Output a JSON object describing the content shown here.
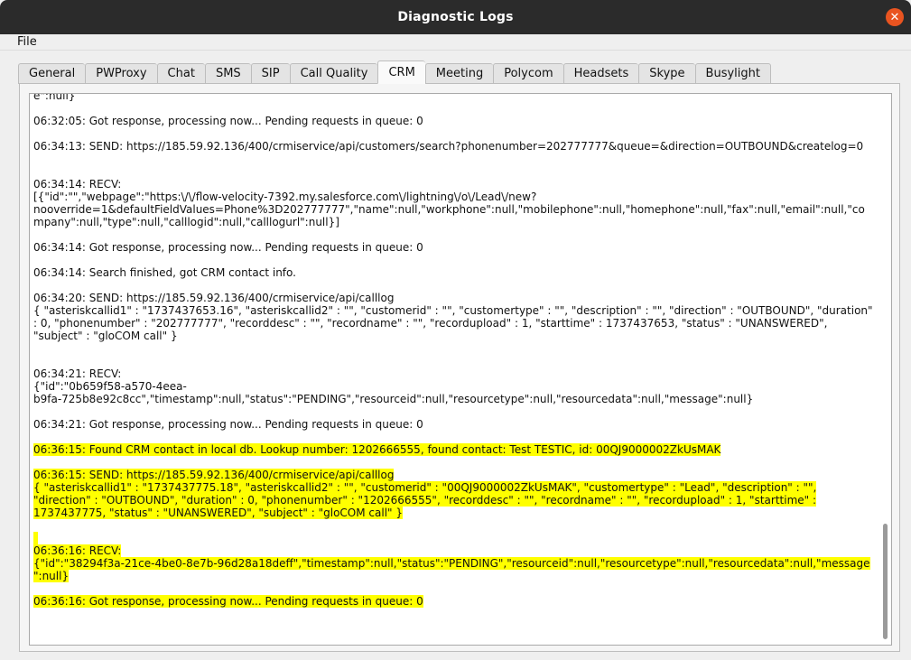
{
  "window": {
    "title": "Diagnostic Logs"
  },
  "menu": {
    "file": "File"
  },
  "tabs": [
    {
      "label": "General"
    },
    {
      "label": "PWProxy"
    },
    {
      "label": "Chat"
    },
    {
      "label": "SMS"
    },
    {
      "label": "SIP"
    },
    {
      "label": "Call Quality"
    },
    {
      "label": "CRM"
    },
    {
      "label": "Meeting"
    },
    {
      "label": "Polycom"
    },
    {
      "label": "Headsets"
    },
    {
      "label": "Skype"
    },
    {
      "label": "Busylight"
    }
  ],
  "active_tab": "CRM",
  "log": [
    {
      "text": "e\":null}",
      "highlight": false
    },
    {
      "text": "06:32:05: Got response, processing now... Pending requests in queue: 0",
      "highlight": false
    },
    {
      "text": "06:34:13: SEND: https://185.59.92.136/400/crmiservice/api/customers/search?phonenumber=202777777&queue=&direction=OUTBOUND&createlog=0",
      "highlight": false,
      "extra_blank": true
    },
    {
      "text": "06:34:14: RECV:\n[{\"id\":\"\",\"webpage\":\"https:\\/\\/flow-velocity-7392.my.salesforce.com\\/lightning\\/o\\/Lead\\/new?\nnooverride=1&defaultFieldValues=Phone%3D202777777\",\"name\":null,\"workphone\":null,\"mobilephone\":null,\"homephone\":null,\"fax\":null,\"email\":null,\"co\nmpany\":null,\"type\":null,\"calllogid\":null,\"calllogurl\":null}]",
      "highlight": false
    },
    {
      "text": "06:34:14: Got response, processing now... Pending requests in queue: 0",
      "highlight": false
    },
    {
      "text": "06:34:14: Search finished, got CRM contact info.",
      "highlight": false
    },
    {
      "text": "06:34:20: SEND: https://185.59.92.136/400/crmiservice/api/calllog\n{ \"asteriskcallid1\" : \"1737437653.16\", \"asteriskcallid2\" : \"\", \"customerid\" : \"\", \"customertype\" : \"\", \"description\" : \"\", \"direction\" : \"OUTBOUND\", \"duration\"\n: 0, \"phonenumber\" : \"202777777\", \"recorddesc\" : \"\", \"recordname\" : \"\", \"recordupload\" : 1, \"starttime\" : 1737437653, \"status\" : \"UNANSWERED\",\n\"subject\" : \"gloCOM call\" }",
      "highlight": false,
      "extra_blank": true
    },
    {
      "text": "06:34:21: RECV:\n{\"id\":\"0b659f58-a570-4eea-\nb9fa-725b8e92c8cc\",\"timestamp\":null,\"status\":\"PENDING\",\"resourceid\":null,\"resourcetype\":null,\"resourcedata\":null,\"message\":null}",
      "highlight": false
    },
    {
      "text": "06:34:21: Got response, processing now... Pending requests in queue: 0",
      "highlight": false
    },
    {
      "text": "06:36:15: Found CRM contact in local db. Lookup number: 1202666555, found contact: Test TESTIC, id: 00QJ9000002ZkUsMAK",
      "highlight": true
    },
    {
      "text": "06:36:15: SEND: https://185.59.92.136/400/crmiservice/api/calllog\n{ \"asteriskcallid1\" : \"1737437775.18\", \"asteriskcallid2\" : \"\", \"customerid\" : \"00QJ9000002ZkUsMAK\", \"customertype\" : \"Lead\", \"description\" : \"\",\n\"direction\" : \"OUTBOUND\", \"duration\" : 0, \"phonenumber\" : \"1202666555\", \"recorddesc\" : \"\", \"recordname\" : \"\", \"recordupload\" : 1, \"starttime\" :\n1737437775, \"status\" : \"UNANSWERED\", \"subject\" : \"gloCOM call\" }",
      "highlight": true,
      "extra_blank": true
    },
    {
      "text": "06:36:16: RECV:\n{\"id\":\"38294f3a-21ce-4be0-8e7b-96d28a18deff\",\"timestamp\":null,\"status\":\"PENDING\",\"resourceid\":null,\"resourcetype\":null,\"resourcedata\":null,\"message\n\":null}",
      "highlight": true
    },
    {
      "text": "06:36:16: Got response, processing now... Pending requests in queue: 0",
      "highlight": true
    }
  ]
}
